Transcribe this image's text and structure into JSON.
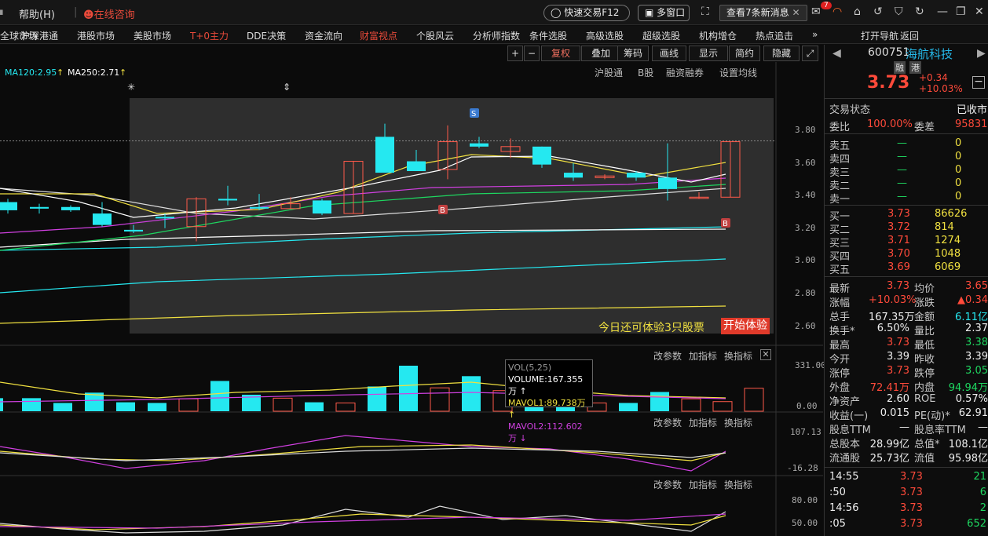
{
  "topbar": {
    "help": "帮助",
    "help_key": "H",
    "consult": "在线咨询",
    "quick_trade": "快速交易F12",
    "multi_window": "多窗口",
    "news": "查看7条新消息",
    "mail_count": "7"
  },
  "nav": [
    "全球市场",
    "沪深港通",
    "港股市场",
    "美股市场",
    "T+0主力",
    "DDE决策",
    "资金流向",
    "财富视点",
    "个股风云",
    "分析师指数",
    "条件选股",
    "高级选股",
    "超级选股",
    "机构增仓",
    "热点追击",
    "»",
    "打开导航",
    "返回"
  ],
  "toolbar": [
    "+",
    "−",
    "复权",
    "叠加",
    "筹码",
    "画线",
    "显示",
    "简约",
    "隐藏"
  ],
  "ma_info": [
    {
      "text": "MA120:2.95",
      "color": "#25e8f0"
    },
    {
      "text": "MA250:2.71",
      "color": "#ffffff"
    }
  ],
  "sublinks": [
    "沪股通",
    "B股",
    "融资融券",
    "设置均线"
  ],
  "promo": {
    "text": "今日还可体验3只股票",
    "button": "开始体验"
  },
  "panel_tabs": [
    "改参数",
    "加指标",
    "换指标"
  ],
  "vol_tooltip": {
    "title": "VOL(5,25)",
    "volume": "VOLUME:167.355万",
    "ma1": "MAVOL1:89.738万",
    "ma2": "MAVOL2:112.602万"
  },
  "vol_axis": [
    "331.00",
    "0.00"
  ],
  "ind1_axis": [
    "107.13",
    "-16.28"
  ],
  "ind2_axis": [
    "80.00",
    "50.00"
  ],
  "chart_data": {
    "type": "candlestick",
    "y_ticks": [
      "3.80",
      "3.60",
      "3.40",
      "3.20",
      "3.00",
      "2.80",
      "2.60"
    ],
    "marker_labels": [
      "S",
      "B",
      "B"
    ],
    "candles": [
      {
        "o": 3.36,
        "c": 3.31,
        "h": 3.38,
        "l": 3.29
      },
      {
        "o": 3.33,
        "c": 3.32,
        "h": 3.35,
        "l": 3.29
      },
      {
        "o": 3.33,
        "c": 3.31,
        "h": 3.34,
        "l": 3.3
      },
      {
        "o": 3.29,
        "c": 3.22,
        "h": 3.36,
        "l": 3.21
      },
      {
        "o": 3.19,
        "c": 3.18,
        "h": 3.22,
        "l": 3.17
      },
      {
        "o": 3.27,
        "c": 3.26,
        "h": 3.29,
        "l": 3.2
      },
      {
        "o": 3.21,
        "c": 3.38,
        "h": 3.39,
        "l": 3.12
      },
      {
        "o": 3.38,
        "c": 3.37,
        "h": 3.46,
        "l": 3.34
      },
      {
        "o": 3.33,
        "c": 3.32,
        "h": 3.41,
        "l": 3.31
      },
      {
        "o": 3.32,
        "c": 3.35,
        "h": 3.39,
        "l": 3.32
      },
      {
        "o": 3.37,
        "c": 3.29,
        "h": 3.38,
        "l": 3.28
      },
      {
        "o": 3.29,
        "c": 3.61,
        "h": 3.61,
        "l": 3.29
      },
      {
        "o": 3.76,
        "c": 3.54,
        "h": 3.84,
        "l": 3.54
      },
      {
        "o": 3.61,
        "c": 3.55,
        "h": 3.68,
        "l": 3.55
      },
      {
        "o": 3.56,
        "c": 3.73,
        "h": 3.83,
        "l": 3.5
      },
      {
        "o": 3.72,
        "c": 3.7,
        "h": 3.76,
        "l": 3.69
      },
      {
        "o": 3.67,
        "c": 3.7,
        "h": 3.75,
        "l": 3.63
      },
      {
        "o": 3.7,
        "c": 3.59,
        "h": 3.7,
        "l": 3.57
      },
      {
        "o": 3.54,
        "c": 3.51,
        "h": 3.6,
        "l": 3.49
      },
      {
        "o": 3.51,
        "c": 3.52,
        "h": 3.53,
        "l": 3.5
      },
      {
        "o": 3.54,
        "c": 3.51,
        "h": 3.55,
        "l": 3.49
      },
      {
        "o": 3.51,
        "c": 3.44,
        "h": 3.72,
        "l": 3.37
      },
      {
        "o": 3.39,
        "c": 3.39,
        "h": 3.42,
        "l": 3.38
      },
      {
        "o": 3.39,
        "c": 3.73,
        "h": 3.73,
        "l": 3.39
      }
    ],
    "volumes": [
      95,
      95,
      60,
      135,
      65,
      60,
      90,
      220,
      120,
      95,
      65,
      60,
      180,
      331,
      170,
      255,
      150,
      110,
      130,
      60,
      60,
      140,
      90,
      70,
      167
    ]
  },
  "quote": {
    "code": "600751",
    "name": "海航科技",
    "tag1": "融",
    "tag2": "港",
    "price": "3.73",
    "chg": "+0.34",
    "pct": "+10.03%",
    "status_lbl": "交易状态",
    "status": "已收市",
    "wb_lbl": "委比",
    "wb": "100.00%",
    "wc_lbl": "委差",
    "wc": "95831",
    "asks": [
      [
        "卖五",
        "—",
        "0"
      ],
      [
        "卖四",
        "—",
        "0"
      ],
      [
        "卖三",
        "—",
        "0"
      ],
      [
        "卖二",
        "—",
        "0"
      ],
      [
        "卖一",
        "—",
        "0"
      ]
    ],
    "bids": [
      [
        "买一",
        "3.73",
        "86626"
      ],
      [
        "买二",
        "3.72",
        "814"
      ],
      [
        "买三",
        "3.71",
        "1274"
      ],
      [
        "买四",
        "3.70",
        "1048"
      ],
      [
        "买五",
        "3.69",
        "6069"
      ]
    ],
    "stats": [
      [
        "最新",
        "3.73",
        "均价",
        "3.65"
      ],
      [
        "涨幅",
        "+10.03%",
        "涨跌",
        "▲0.34"
      ],
      [
        "总手",
        "167.35万",
        "金额",
        "6.11亿"
      ],
      [
        "换手*",
        "6.50%",
        "量比",
        "2.37"
      ],
      [
        "最高",
        "3.73",
        "最低",
        "3.38"
      ],
      [
        "今开",
        "3.39",
        "昨收",
        "3.39"
      ],
      [
        "涨停",
        "3.73",
        "跌停",
        "3.05"
      ],
      [
        "外盘",
        "72.41万",
        "内盘",
        "94.94万"
      ],
      [
        "净资产",
        "2.60",
        "ROE",
        "0.57%"
      ],
      [
        "收益(一)",
        "0.015",
        "PE(动)*",
        "62.91"
      ],
      [
        "股息TTM",
        "—",
        "股息率TTM",
        "—"
      ],
      [
        "总股本",
        "28.99亿",
        "总值*",
        "108.1亿"
      ],
      [
        "流通股",
        "25.73亿",
        "流值",
        "95.98亿"
      ]
    ],
    "ticks": [
      [
        "14:55",
        "3.73",
        "21"
      ],
      [
        ":50",
        "3.73",
        "6"
      ],
      [
        "14:56",
        "3.73",
        "2"
      ],
      [
        ":05",
        "3.73",
        "652"
      ]
    ]
  }
}
